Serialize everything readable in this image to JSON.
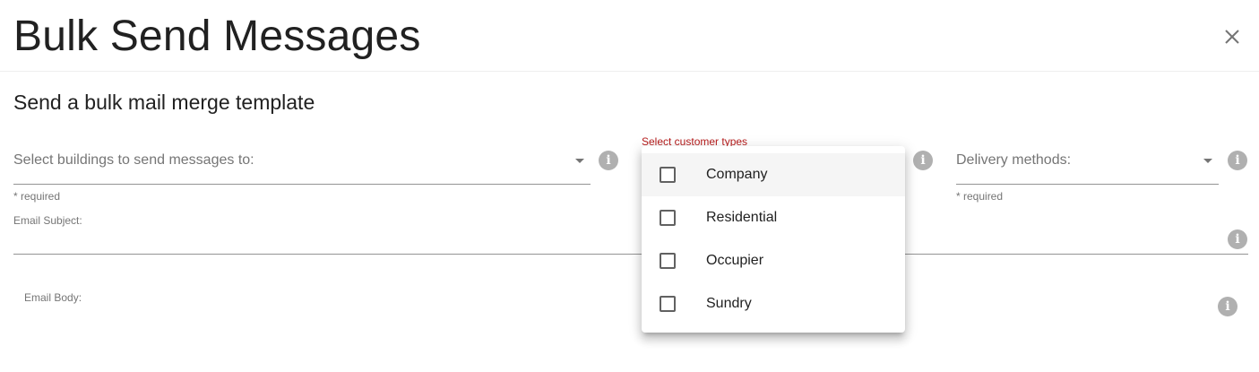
{
  "dialog": {
    "title": "Bulk Send Messages",
    "close_icon": "close-icon"
  },
  "subtitle": "Send a bulk mail merge template",
  "buildings_select": {
    "placeholder": "Select buildings to send messages to:",
    "hint": "* required",
    "icon": "info-icon"
  },
  "customer_types": {
    "label": "Select customer types",
    "label_color": "#b71c1c",
    "options": [
      {
        "label": "Company",
        "checked": false,
        "hovered": true
      },
      {
        "label": "Residential",
        "checked": false,
        "hovered": false
      },
      {
        "label": "Occupier",
        "checked": false,
        "hovered": false
      },
      {
        "label": "Sundry",
        "checked": false,
        "hovered": false
      }
    ]
  },
  "delivery_methods": {
    "placeholder": "Delivery methods:",
    "hint": "* required"
  },
  "email_subject": {
    "label": "Email Subject:"
  },
  "email_body": {
    "label": "Email Body:"
  },
  "info_glyph": "i"
}
